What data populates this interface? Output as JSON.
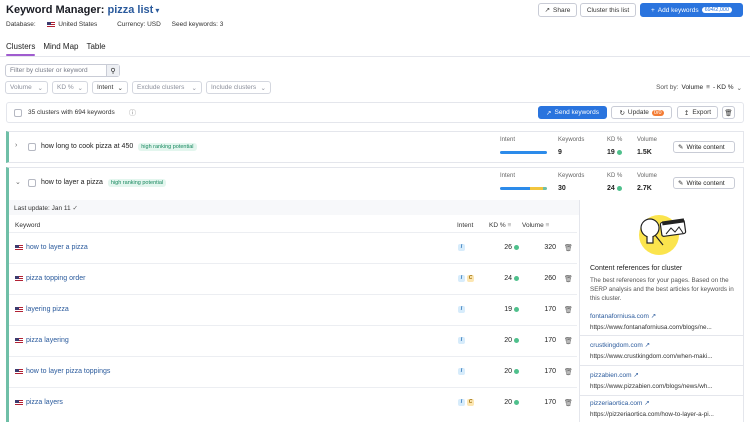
{
  "header": {
    "title": "Keyword Manager:",
    "project": "pizza list",
    "database_label": "Database:",
    "database_value": "United States",
    "currency": "Currency: USD",
    "seed": "Seed keywords: 3",
    "share_label": "Share",
    "cluster_list_label": "Cluster this list",
    "add_keywords_label": "Add keywords",
    "add_keywords_count": "694/2,000"
  },
  "tabs": [
    {
      "label": "Clusters",
      "active": true
    },
    {
      "label": "Mind Map",
      "active": false
    },
    {
      "label": "Table",
      "active": false
    }
  ],
  "filters": {
    "search_placeholder": "Filter by cluster or keyword",
    "volume": "Volume",
    "kd": "KD %",
    "intent": "Intent",
    "exclude": "Exclude clusters",
    "include": "Include clusters",
    "sort_label": "Sort by:",
    "sort_value": "Volume",
    "sort_value2": "- KD %"
  },
  "toolbar": {
    "summary": "35 clusters with 694 keywords",
    "send_label": "Send keywords",
    "update_label": "Update",
    "update_count": "0/0",
    "export_label": "Export"
  },
  "clusters": [
    {
      "name": "how long to cook pizza at 450",
      "badge": "high ranking potential",
      "intent_label": "Intent",
      "keywords_label": "Keywords",
      "keywords": "9",
      "kd_label": "KD %",
      "kd": "19",
      "volume_label": "Volume",
      "volume": "1.5K",
      "write_label": "Write content"
    },
    {
      "name": "how to layer a pizza",
      "badge": "high ranking potential",
      "intent_label": "Intent",
      "keywords_label": "Keywords",
      "keywords": "30",
      "kd_label": "KD %",
      "kd": "24",
      "volume_label": "Volume",
      "volume": "2.7K",
      "write_label": "Write content"
    }
  ],
  "expanded": {
    "last_update": "Last update: Jan 11",
    "col_keyword": "Keyword",
    "col_intent": "Intent",
    "col_kd": "KD %",
    "col_volume": "Volume",
    "rows": [
      {
        "keyword": "how to layer a pizza",
        "intents": [
          "I"
        ],
        "kd": "26",
        "volume": "320"
      },
      {
        "keyword": "pizza topping order",
        "intents": [
          "I",
          "C"
        ],
        "kd": "24",
        "volume": "260"
      },
      {
        "keyword": "layering pizza",
        "intents": [
          "I"
        ],
        "kd": "19",
        "volume": "170"
      },
      {
        "keyword": "pizza layering",
        "intents": [
          "I"
        ],
        "kd": "20",
        "volume": "170"
      },
      {
        "keyword": "how to layer pizza toppings",
        "intents": [
          "I"
        ],
        "kd": "20",
        "volume": "170"
      },
      {
        "keyword": "pizza layers",
        "intents": [
          "I",
          "C"
        ],
        "kd": "20",
        "volume": "170"
      }
    ]
  },
  "panel": {
    "title": "Content references for cluster",
    "desc": "The best references for your pages. Based on the SERP analysis and the best articles for keywords in this cluster.",
    "refs": [
      {
        "domain": "fontanaforniusa.com",
        "url": "https://www.fontanaforniusa.com/blogs/ne..."
      },
      {
        "domain": "crustkingdom.com",
        "url": "https://www.crustkingdom.com/when-maki..."
      },
      {
        "domain": "pizzabien.com",
        "url": "https://www.pizzabien.com/blogs/news/wh..."
      },
      {
        "domain": "pizzeriaortica.com",
        "url": "https://pizzeriaortica.com/how-to-layer-a-pi..."
      }
    ]
  }
}
